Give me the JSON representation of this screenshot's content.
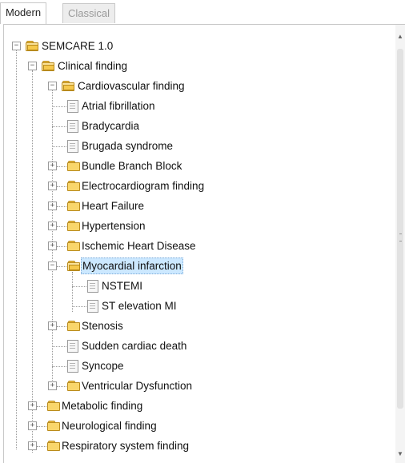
{
  "tabs": [
    {
      "label": "Modern",
      "active": true
    },
    {
      "label": "Classical",
      "active": false
    }
  ],
  "tree": {
    "root": {
      "label": "SEMCARE 1.0",
      "icon": "folder-open-icon",
      "expanded": true
    },
    "clinical": {
      "label": "Clinical finding",
      "icon": "folder-open-icon",
      "expanded": true
    },
    "cardio": {
      "label": "Cardiovascular finding",
      "icon": "folder-open-icon",
      "expanded": true
    },
    "cardio_children": [
      {
        "label": "Atrial fibrillation",
        "icon": "document-icon"
      },
      {
        "label": "Bradycardia",
        "icon": "document-icon"
      },
      {
        "label": "Brugada syndrome",
        "icon": "document-icon"
      },
      {
        "label": "Bundle Branch Block",
        "icon": "folder-icon"
      },
      {
        "label": "Electrocardiogram finding",
        "icon": "folder-icon"
      },
      {
        "label": "Heart Failure",
        "icon": "folder-icon"
      },
      {
        "label": "Hypertension",
        "icon": "folder-icon"
      },
      {
        "label": "Ischemic Heart Disease",
        "icon": "folder-icon"
      },
      {
        "label": "Myocardial infarction",
        "icon": "folder-open-icon",
        "selected": true
      },
      {
        "label": "Stenosis",
        "icon": "folder-icon"
      },
      {
        "label": "Sudden cardiac death",
        "icon": "document-icon"
      },
      {
        "label": "Syncope",
        "icon": "document-icon"
      },
      {
        "label": "Ventricular Dysfunction",
        "icon": "folder-icon"
      }
    ],
    "mi_children": [
      {
        "label": "NSTEMI",
        "icon": "document-icon"
      },
      {
        "label": "ST elevation MI",
        "icon": "document-icon"
      }
    ],
    "clinical_children": [
      {
        "label": "Metabolic finding",
        "icon": "folder-icon"
      },
      {
        "label": "Neurological finding",
        "icon": "folder-icon"
      },
      {
        "label": "Respiratory system finding",
        "icon": "folder-icon"
      }
    ]
  },
  "colors": {
    "selection": "#cce8ff",
    "folder": "#f9d66b"
  }
}
